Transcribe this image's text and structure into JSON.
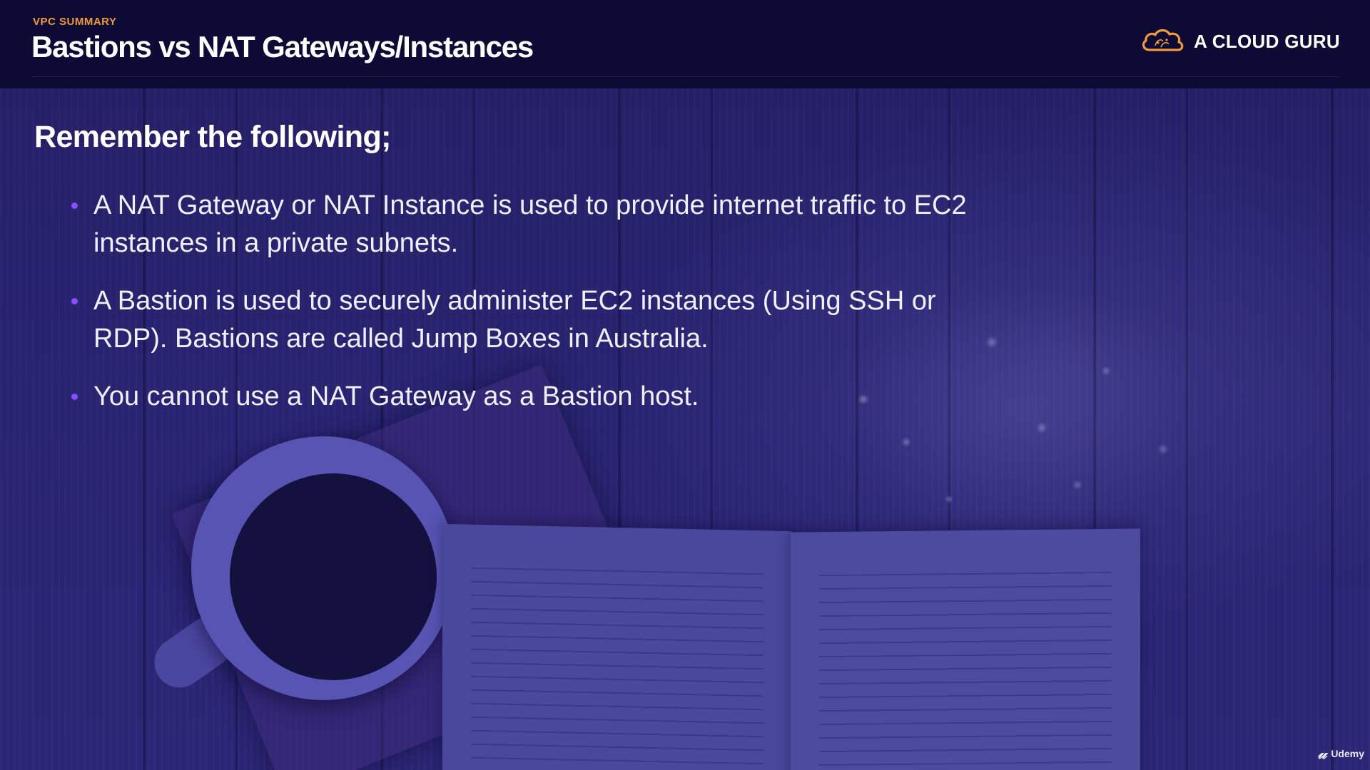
{
  "header": {
    "section_label": "VPC SUMMARY",
    "title": "Bastions vs NAT Gateways/Instances",
    "brand_name": "A CLOUD GURU",
    "brand_icon": "cloud-logo-icon"
  },
  "content": {
    "subheading": "Remember the following;",
    "bullets": [
      "A NAT Gateway or NAT Instance is used to provide internet traffic to EC2 instances in a private subnets.",
      "A Bastion is used to securely administer EC2 instances (Using SSH or RDP). Bastions are called Jump Boxes in Australia.",
      "You cannot use a NAT Gateway as a Bastion host."
    ]
  },
  "watermark": {
    "label": "Udemy",
    "icon": "udemy-logo-icon"
  },
  "colors": {
    "header_bg": "#0d0a36",
    "accent_orange": "#f39a3c",
    "bullet_purple": "#8a4dff",
    "background": "#2a2574"
  }
}
